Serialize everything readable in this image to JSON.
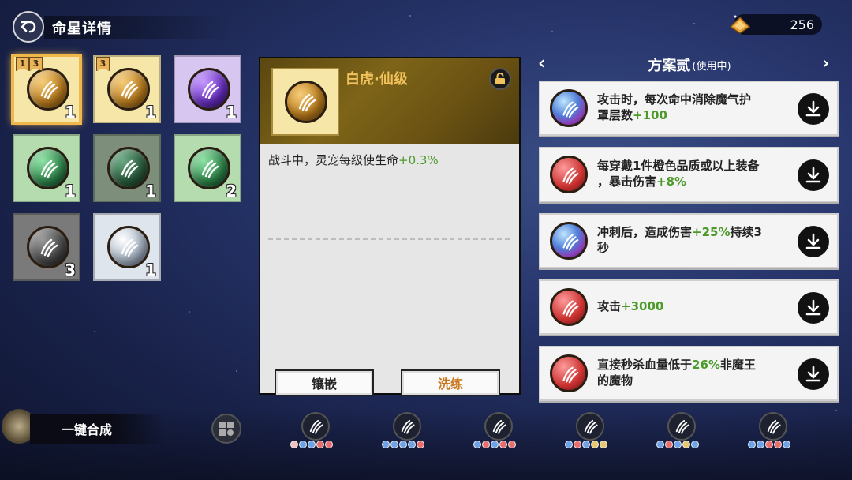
{
  "header": {
    "title": "命星详情",
    "currency": {
      "icon": "gold-ingot-icon",
      "value": "256"
    }
  },
  "gems": [
    {
      "color": "gold",
      "count": "1",
      "tags": [
        "1",
        "3"
      ],
      "selected": true
    },
    {
      "color": "gold",
      "count": "1",
      "tags": [
        "3"
      ],
      "selected": false
    },
    {
      "color": "purple",
      "count": "1",
      "tags": [],
      "selected": false
    },
    {
      "color": "green",
      "count": "1",
      "tags": [],
      "selected": false
    },
    {
      "color": "dark-green",
      "count": "1",
      "tags": [],
      "selected": false
    },
    {
      "color": "green",
      "count": "2",
      "tags": [],
      "selected": false
    },
    {
      "color": "dark-gray",
      "count": "3",
      "tags": [],
      "selected": false
    },
    {
      "color": "silver",
      "count": "1",
      "tags": [],
      "selected": false
    }
  ],
  "detail": {
    "title": "白虎·仙级",
    "desc_prefix": "战斗中，灵宠每级使生命",
    "desc_value": "+0.3%",
    "inlay_label": "镶嵌",
    "refine_label": "洗练"
  },
  "plan": {
    "name": "方案贰",
    "status": "(使用中)",
    "prev_arrow": "‹",
    "next_arrow": "›",
    "items": [
      {
        "color": "blue",
        "line1": "攻击时，每次命中消除魔气护",
        "line2_prefix": "罩层数",
        "value": "+100",
        "line2_suffix": ""
      },
      {
        "color": "red",
        "line1": "每穿戴1件橙色品质或以上装备",
        "line2_prefix": "，暴击伤害",
        "value": "+8%",
        "line2_suffix": ""
      },
      {
        "color": "blue",
        "line1_prefix": "冲刺后，造成伤害",
        "value": "+25%",
        "line1_suffix": "持续3",
        "line2": "秒"
      },
      {
        "color": "red",
        "single_prefix": "攻击",
        "value": "+3000"
      },
      {
        "color": "red",
        "line1_prefix": "直接秒杀血量低于",
        "value": "26%",
        "line1_suffix": "非魔王",
        "line2": "的魔物"
      }
    ]
  },
  "bottom": {
    "compose_label": "一键合成",
    "categories": [
      {
        "icon": "claw-icon",
        "dots": [
          "#f2c0c0",
          "#6fa3e8",
          "#6fa3e8",
          "#e86f6f",
          "#e86f6f"
        ]
      },
      {
        "icon": "moon-icon",
        "dots": [
          "#6fa3e8",
          "#6fa3e8",
          "#6fa3e8",
          "#6fa3e8",
          "#e86f6f"
        ]
      },
      {
        "icon": "scratch-icon",
        "dots": [
          "#6fa3e8",
          "#e86f6f",
          "#6fa3e8",
          "#e86f6f",
          "#e86f6f"
        ]
      },
      {
        "icon": "stone-icon",
        "dots": [
          "#6fa3e8",
          "#e86f6f",
          "#6fa3e8",
          "#e8c86f",
          "#e8c86f"
        ]
      },
      {
        "icon": "beast-icon",
        "dots": [
          "#6fa3e8",
          "#e86f6f",
          "#6fa3e8",
          "#e8c86f",
          "#6fa3e8"
        ]
      },
      {
        "icon": "skull-icon",
        "dots": [
          "#6fa3e8",
          "#6fa3e8",
          "#e86f6f",
          "#e86f6f",
          "#6fa3e8"
        ]
      }
    ]
  }
}
